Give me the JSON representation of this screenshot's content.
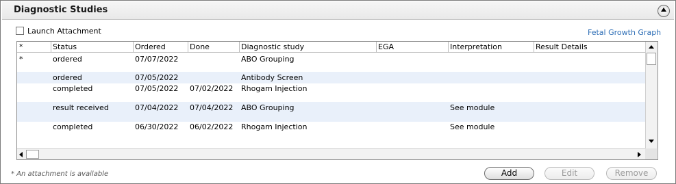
{
  "panel": {
    "title": "Diagnostic Studies",
    "collapse_icon": "chevron-up-circle-icon"
  },
  "launch_attachment": {
    "label": "Launch Attachment",
    "checked": false
  },
  "fetal_growth_link": "Fetal Growth Graph",
  "table": {
    "columns": [
      "*",
      "Status",
      "Ordered",
      "Done",
      "Diagnostic study",
      "EGA",
      "Interpretation",
      "Result Details"
    ],
    "rows": [
      {
        "flag": "*",
        "status": "ordered",
        "ordered": "07/07/2022",
        "done": "",
        "study": "ABO Grouping",
        "ega": "",
        "interpretation": "",
        "details": ""
      },
      {
        "flag": "",
        "status": "ordered",
        "ordered": "07/05/2022",
        "done": "",
        "study": "Antibody Screen",
        "ega": "",
        "interpretation": "",
        "details": ""
      },
      {
        "flag": "",
        "status": "completed",
        "ordered": "07/05/2022",
        "done": "07/02/2022",
        "study": "Rhogam Injection",
        "ega": "",
        "interpretation": "",
        "details": ""
      },
      {
        "flag": "",
        "status": "result received",
        "ordered": "07/04/2022",
        "done": "07/04/2022",
        "study": "ABO Grouping",
        "ega": "",
        "interpretation": "See module",
        "details": ""
      },
      {
        "flag": "",
        "status": "completed",
        "ordered": "06/30/2022",
        "done": "06/02/2022",
        "study": "Rhogam Injection",
        "ega": "",
        "interpretation": "See module",
        "details": ""
      }
    ]
  },
  "footnote": "*  An attachment is available",
  "buttons": {
    "add": "Add",
    "edit": "Edit",
    "remove": "Remove"
  },
  "colors": {
    "link": "#2f6fb6",
    "row_shade": "#e9f0fa"
  }
}
